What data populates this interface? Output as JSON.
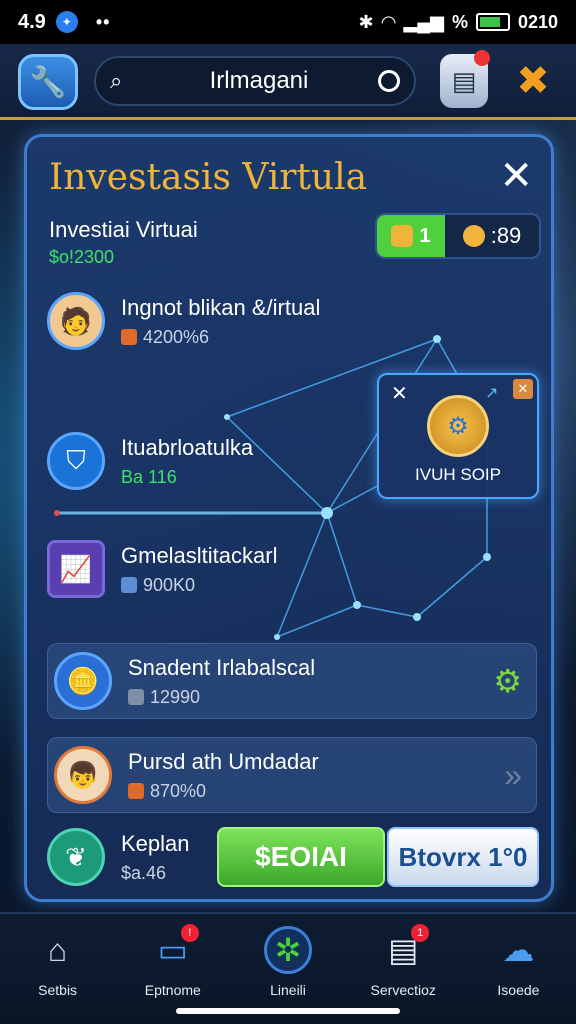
{
  "status_bar": {
    "time": "4.9",
    "right_text": "%",
    "clock": "0210"
  },
  "top_bar": {
    "search_text": "Irlmagani"
  },
  "panel": {
    "title": "Investasis Virtula",
    "subtitle": "Investiai Virtuai",
    "subtitle_value": "$o!2300",
    "pill_left": "1",
    "pill_right": ":89",
    "popup_label": "IVUH SOIP"
  },
  "rows": [
    {
      "name": "Ingnot blikan &/irtual",
      "value": "4200%6",
      "tag_color": "#e06a2a"
    },
    {
      "name": "Ituabrloatulka",
      "value": "Ba 116",
      "value_color": "#3ee06a"
    },
    {
      "name": "Gmelasltitackarl",
      "value": "900K0",
      "tag_color": "#5a8fd6"
    },
    {
      "name": "Snadent Irlabalscal",
      "value": "12990",
      "tag_color": "#7f8fa6"
    },
    {
      "name": "Pursd ath Umdadar",
      "value": "870%0",
      "tag_color": "#e06a2a"
    },
    {
      "name": "Keplan",
      "value": "$a.46"
    }
  ],
  "buttons": {
    "green": "$EOIAI",
    "white": "Btovrx 1°0"
  },
  "bottom_nav": [
    {
      "label": "Setbis",
      "icon": "home-icon"
    },
    {
      "label": "Eptnome",
      "icon": "monitor-icon"
    },
    {
      "label": "Lineili",
      "icon": "leaf-icon"
    },
    {
      "label": "Servectioz",
      "icon": "document-icon"
    },
    {
      "label": "Isoede",
      "icon": "cloud-icon"
    }
  ],
  "colors": {
    "accent_gold": "#f0b43a",
    "accent_green": "#4fd13d",
    "panel_border": "#3f7ecf"
  }
}
